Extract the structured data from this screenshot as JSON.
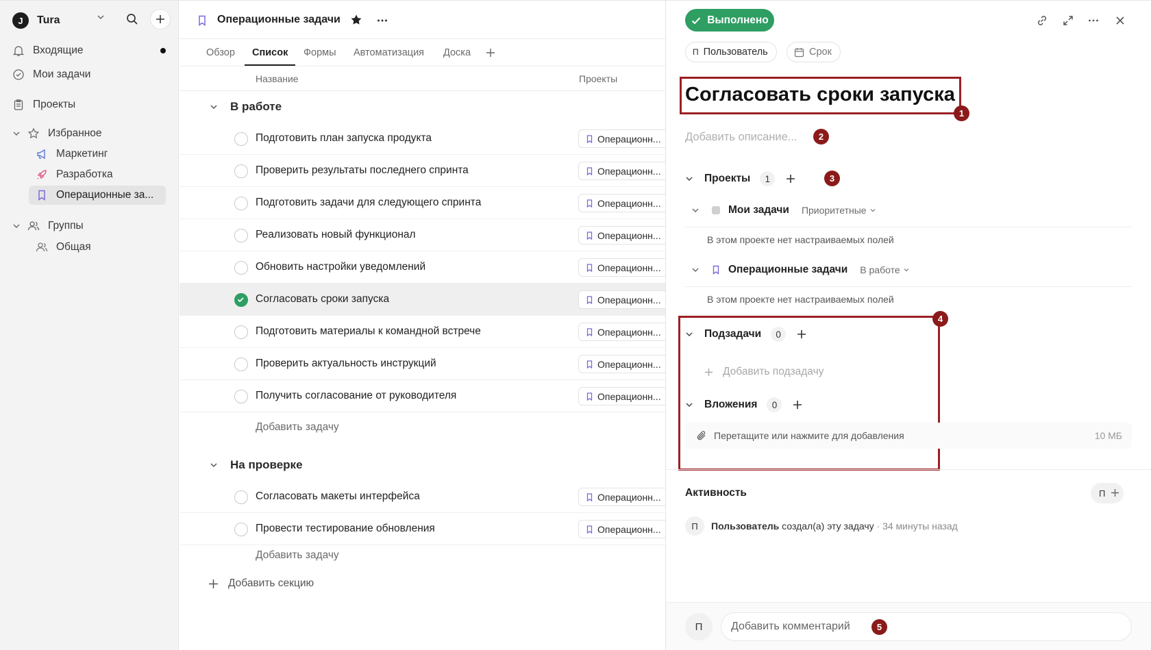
{
  "workspace": {
    "logo": "J",
    "name": "Tura"
  },
  "sidebar": {
    "nav": [
      {
        "label": "Входящие"
      },
      {
        "label": "Мои задачи"
      },
      {
        "label": "Проекты"
      }
    ],
    "favorites_label": "Избранное",
    "favorites": [
      {
        "label": "Маркетинг",
        "color": "#5b7bd5"
      },
      {
        "label": "Разработка",
        "color": "#e0568a"
      },
      {
        "label": "Операционные за...",
        "color": "#7b68d9"
      }
    ],
    "groups_label": "Группы",
    "groups": [
      {
        "label": "Общая"
      }
    ]
  },
  "project": {
    "title": "Операционные задачи",
    "tabs": [
      "Обзор",
      "Список",
      "Формы",
      "Автоматизация",
      "Доска"
    ],
    "active_tab": "Список",
    "columns": {
      "name": "Название",
      "projects": "Проекты"
    },
    "sections": [
      {
        "title": "В работе",
        "tasks": [
          {
            "name": "Подготовить план запуска продукта",
            "project": "Операционн..."
          },
          {
            "name": "Проверить результаты последнего спринта",
            "project": "Операционн..."
          },
          {
            "name": "Подготовить задачи для следующего спринта",
            "project": "Операционн..."
          },
          {
            "name": "Реализовать новый функционал",
            "project": "Операционн..."
          },
          {
            "name": "Обновить настройки уведомлений",
            "project": "Операционн..."
          },
          {
            "name": "Согласовать сроки запуска",
            "project": "Операционн...",
            "done": true,
            "selected": true
          },
          {
            "name": "Подготовить материалы к командной встрече",
            "project": "Операционн..."
          },
          {
            "name": "Проверить актуальность инструкций",
            "project": "Операционн..."
          },
          {
            "name": "Получить согласование от руководителя",
            "project": "Операционн..."
          }
        ],
        "add_label": "Добавить задачу"
      },
      {
        "title": "На проверке",
        "tasks": [
          {
            "name": "Согласовать макеты интерфейса",
            "project": "Операционн..."
          },
          {
            "name": "Провести тестирование обновления",
            "project": "Операционн..."
          }
        ],
        "add_label": "Добавить задачу"
      }
    ],
    "add_section_label": "Добавить секцию"
  },
  "detail": {
    "status_label": "Выполнено",
    "assignee": {
      "initial": "П",
      "name": "Пользователь"
    },
    "due_label": "Срок",
    "title": "Согласовать сроки запуска",
    "description_placeholder": "Добавить описание...",
    "projects": {
      "label": "Проекты",
      "count": "1"
    },
    "project_rows": [
      {
        "name": "Мои задачи",
        "status": "Приоритетные",
        "no_fields": "В этом проекте нет настраиваемых полей"
      },
      {
        "name": "Операционные задачи",
        "status": "В работе",
        "no_fields": "В этом проекте нет настраиваемых полей"
      }
    ],
    "subtasks": {
      "label": "Подзадачи",
      "count": "0",
      "add_label": "Добавить подзадачу"
    },
    "attachments": {
      "label": "Вложения",
      "count": "0",
      "drop_label": "Перетащите или нажмите для добавления",
      "size_limit": "10 МБ"
    },
    "activity": {
      "label": "Активность",
      "follower_initial": "П",
      "log": {
        "initial": "П",
        "who": "Пользователь",
        "action": "создал(а) эту задачу",
        "when": "· 34 минуты назад"
      }
    },
    "comment": {
      "initial": "П",
      "placeholder": "Добавить комментарий"
    }
  },
  "annotations": [
    "1",
    "2",
    "3",
    "4",
    "5"
  ],
  "colors": {
    "done": "#2e9e63",
    "annotation": "#8b1a1a"
  }
}
